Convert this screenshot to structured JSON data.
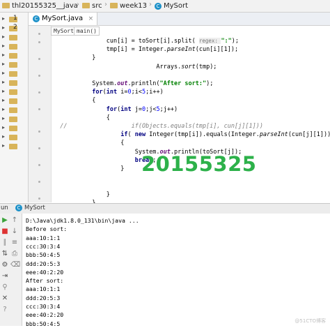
{
  "breadcrumb": {
    "project": "thl20155325__java",
    "src": "src",
    "pkg": "week13",
    "cls": "MySort"
  },
  "tabs": [
    {
      "label": "MySort.java",
      "close": "×"
    }
  ],
  "tree": {
    "rows": [
      "1",
      "2",
      "",
      "",
      "",
      "",
      "",
      "",
      "",
      "",
      "",
      "",
      "",
      "",
      ""
    ]
  },
  "method_crumbs": [
    "MySort",
    "main()"
  ],
  "code_lines": [
    {
      "indent": "               ",
      "parts": [
        [
          "",
          "cun[i] = toSort[i].split( "
        ],
        [
          "hint",
          "regex: "
        ],
        [
          "str",
          "\":\""
        ],
        [
          "",
          ");"
        ]
      ]
    },
    {
      "indent": "               ",
      "parts": [
        [
          "",
          "tmp[i] = Integer."
        ],
        [
          "italic",
          "parseInt"
        ],
        [
          "",
          "(cun[i][1]);"
        ]
      ]
    },
    {
      "indent": "           ",
      "parts": [
        [
          "",
          "}"
        ]
      ]
    },
    {
      "indent": "                             ",
      "parts": [
        [
          "",
          "Arrays."
        ],
        [
          "italic",
          "sort"
        ],
        [
          "",
          "(tmp);"
        ]
      ]
    },
    {
      "indent": "",
      "parts": [
        [
          "",
          ""
        ]
      ]
    },
    {
      "indent": "           ",
      "parts": [
        [
          "",
          "System."
        ],
        [
          "field",
          "out"
        ],
        [
          "",
          ".println("
        ],
        [
          "str",
          "\"After sort:\""
        ],
        [
          "",
          ");"
        ]
      ]
    },
    {
      "indent": "           ",
      "parts": [
        [
          "kw",
          "for"
        ],
        [
          "",
          "("
        ],
        [
          "kw",
          "int"
        ],
        [
          "",
          " i="
        ],
        [
          "num",
          "0"
        ],
        [
          "",
          ";i<"
        ],
        [
          "num",
          "5"
        ],
        [
          "",
          ";i++)"
        ]
      ]
    },
    {
      "indent": "           ",
      "parts": [
        [
          "",
          "{"
        ]
      ]
    },
    {
      "indent": "               ",
      "parts": [
        [
          "kw",
          "for"
        ],
        [
          "",
          "("
        ],
        [
          "kw",
          "int"
        ],
        [
          "",
          " j="
        ],
        [
          "num",
          "0"
        ],
        [
          "",
          ";j<"
        ],
        [
          "num",
          "5"
        ],
        [
          "",
          ";j++)"
        ]
      ]
    },
    {
      "indent": "               ",
      "parts": [
        [
          "",
          "{"
        ]
      ]
    },
    {
      "indent": "  ",
      "parts": [
        [
          "cmt",
          "//                  if(Objects.equals(tmp[i], cun[j][1]))"
        ]
      ]
    },
    {
      "indent": "                   ",
      "parts": [
        [
          "kw",
          "if"
        ],
        [
          "",
          "( "
        ],
        [
          "kw",
          "new"
        ],
        [
          "",
          " Integer(tmp[i]).equals(Integer."
        ],
        [
          "italic",
          "parseInt"
        ],
        [
          "",
          "(cun[j][1])))"
        ]
      ]
    },
    {
      "indent": "                   ",
      "parts": [
        [
          "",
          "{"
        ]
      ]
    },
    {
      "indent": "                       ",
      "parts": [
        [
          "",
          "System."
        ],
        [
          "field",
          "out"
        ],
        [
          "",
          ".println(toSort[j]);"
        ]
      ]
    },
    {
      "indent": "                       ",
      "parts": [
        [
          "kw",
          "break"
        ],
        [
          "",
          ";"
        ]
      ]
    },
    {
      "indent": "                   ",
      "parts": [
        [
          "",
          "}"
        ]
      ]
    },
    {
      "indent": "",
      "parts": [
        [
          "",
          ""
        ]
      ]
    },
    {
      "indent": "",
      "parts": [
        [
          "",
          ""
        ]
      ]
    },
    {
      "indent": "               ",
      "parts": [
        [
          "",
          "}"
        ]
      ]
    },
    {
      "indent": "           ",
      "parts": [
        [
          "",
          "}"
        ]
      ]
    }
  ],
  "gutter_comment_mark": "//",
  "watermark_text": "20155325",
  "run_panel": {
    "title_prefix": "un",
    "tab_label": "MySort"
  },
  "console_lines": [
    "D:\\Java\\jdk1.8.0_131\\bin\\java ...",
    "Before sort:",
    "aaa:10:1:1",
    "ccc:30:3:4",
    "bbb:50:4:5",
    "ddd:20:5:3",
    "eee:40:2:20",
    "After sort:",
    "aaa:10:1:1",
    "ddd:20:5:3",
    "ccc:30:3:4",
    "eee:40:2:20",
    "bbb:50:4:5"
  ],
  "footer_watermark": "@51CTO博客",
  "colors": {
    "accent_green": "#2db14a",
    "class_icon": "#1d91c9",
    "folder": "#d8b45a"
  }
}
